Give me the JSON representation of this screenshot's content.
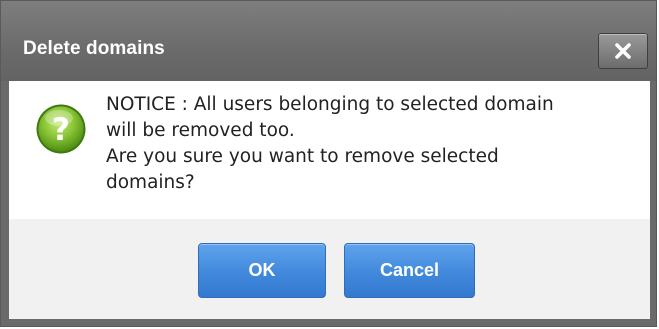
{
  "dialog": {
    "title": "Delete domains",
    "close_icon": "close-icon",
    "icon": "question-icon",
    "message_lines": [
      "NOTICE : All users belonging to selected domain",
      "will be removed too.",
      "Are you sure you want to remove selected",
      "domains?"
    ],
    "ok_label": "OK",
    "cancel_label": "Cancel"
  },
  "colors": {
    "titlebar": "#6b6b6b",
    "button_blue": "#4189dc",
    "icon_green": "#7cb82f",
    "footer": "#f1f1f1"
  }
}
